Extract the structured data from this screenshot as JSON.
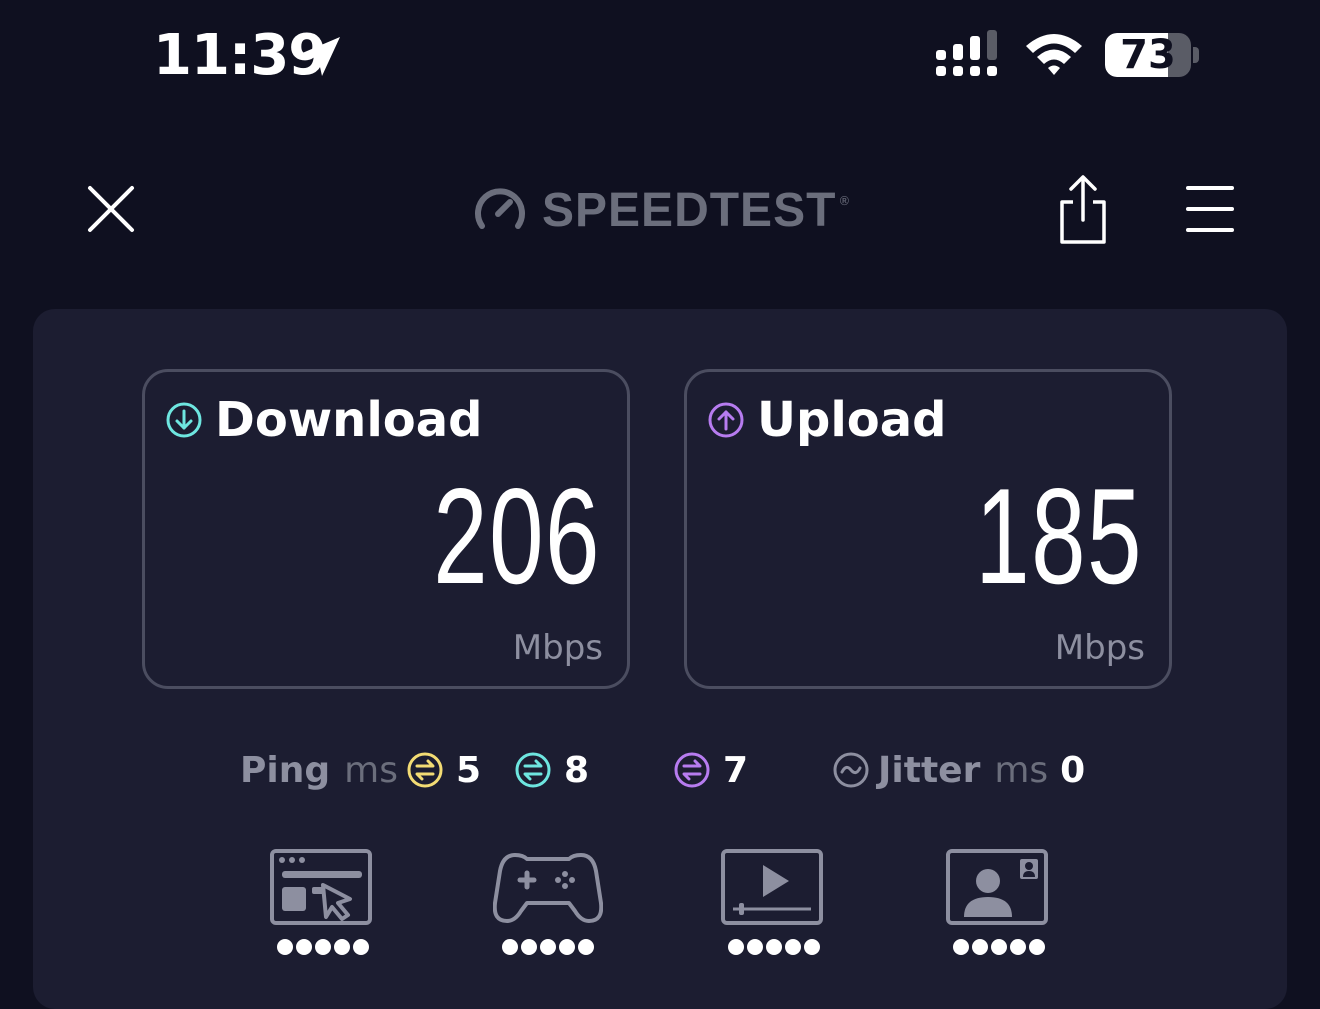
{
  "status_bar": {
    "time": "11:39",
    "battery_percent": "73",
    "battery_level": 0.73,
    "icons": [
      "location-arrow-icon",
      "cellular-signal-icon",
      "wifi-icon",
      "battery-icon"
    ]
  },
  "toolbar": {
    "brand": "SPEEDTEST",
    "brand_mark": "®",
    "icons": [
      "close-icon",
      "speedometer-icon",
      "share-icon",
      "menu-icon"
    ]
  },
  "results": {
    "download": {
      "label": "Download",
      "value": "206",
      "unit": "Mbps",
      "icon": "arrow-down-circle-icon",
      "color": "#6ee6e0"
    },
    "upload": {
      "label": "Upload",
      "value": "185",
      "unit": "Mbps",
      "icon": "arrow-up-circle-icon",
      "color": "#b77cf0"
    },
    "ping": {
      "label": "Ping",
      "unit": "ms",
      "idle": {
        "value": "5",
        "color": "#f3dc74"
      },
      "download": {
        "value": "8",
        "color": "#6ee6e0"
      },
      "upload": {
        "value": "7",
        "color": "#b77cf0"
      }
    },
    "jitter": {
      "label": "Jitter",
      "unit": "ms",
      "value": "0"
    }
  },
  "use_cases": [
    {
      "icon": "web-browsing-icon",
      "rating": 5,
      "max": 5
    },
    {
      "icon": "gaming-controller-icon",
      "rating": 5,
      "max": 5
    },
    {
      "icon": "video-streaming-icon",
      "rating": 5,
      "max": 5
    },
    {
      "icon": "video-chat-icon",
      "rating": 5,
      "max": 5
    }
  ]
}
